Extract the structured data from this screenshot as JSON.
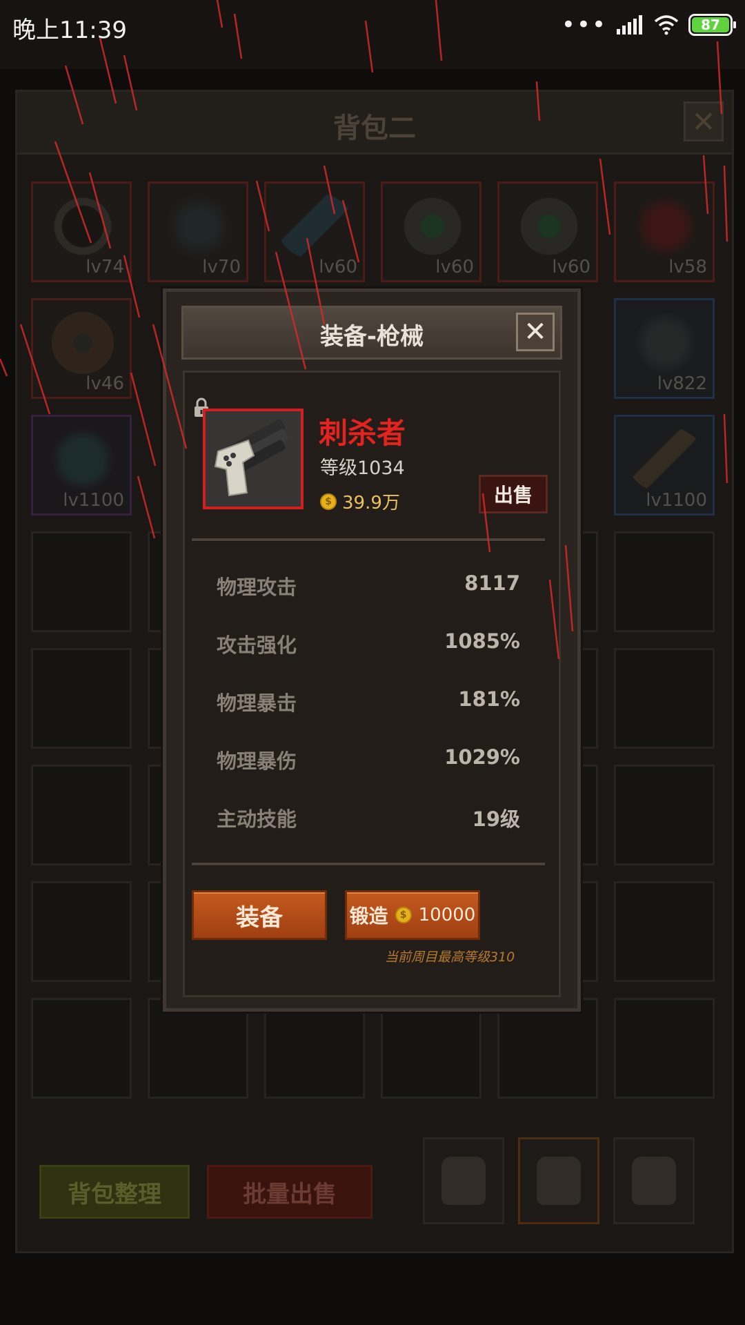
{
  "status_bar": {
    "time": "晚上11:39",
    "battery": "87"
  },
  "bag": {
    "title": "背包二",
    "close_glyph": "✕",
    "slots": [
      {
        "level": "lv74"
      },
      {
        "level": "lv70"
      },
      {
        "level": "lv60"
      },
      {
        "level": "lv60"
      },
      {
        "level": "lv60"
      },
      {
        "level": "lv58"
      },
      {
        "level": "lv46"
      },
      {
        "level": "lv822"
      },
      {
        "level": "lv1100"
      },
      {
        "level": "lv1100"
      }
    ],
    "sort_button": "背包整理",
    "batch_sell_button": "批量出售"
  },
  "modal": {
    "title": "装备-枪械",
    "close_glyph": "✕",
    "item": {
      "name": "刺杀者",
      "level": "等级1034",
      "price": "39.9万",
      "coin_symbol": "$"
    },
    "sell_button": "出售",
    "stats": [
      {
        "label": "物理攻击",
        "value": "8117"
      },
      {
        "label": "攻击强化",
        "value": "1085%"
      },
      {
        "label": "物理暴击",
        "value": "181%"
      },
      {
        "label": "物理暴伤",
        "value": "1029%"
      },
      {
        "label": "主动技能",
        "value": "19级"
      }
    ],
    "equip_button": "装备",
    "forge_button": "锻造",
    "forge_cost": "10000",
    "forge_note": "当前周目最高等级310"
  },
  "colors": {
    "item_name": "#e5221d",
    "coin": "#e6b21a",
    "action_button": "#b34d18",
    "rain": "#d42a2a"
  }
}
